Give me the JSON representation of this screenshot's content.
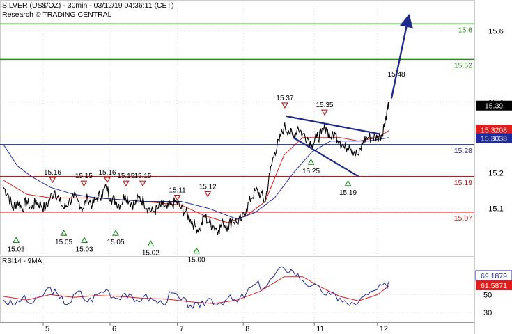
{
  "header": {
    "title": "SILVER (US$/OZ) - 30min - 03/12/19 04:36:11 (CET)",
    "subtitle": "Research © TRADING CENTRAL"
  },
  "chart_data": [
    {
      "type": "line",
      "name": "price",
      "x_labels": [
        "5",
        "6",
        "7",
        "8",
        "11",
        "12"
      ],
      "ylim": [
        14.97,
        15.66
      ],
      "yticks": [
        15.1,
        15.2,
        15.4,
        15.6
      ],
      "grid": true,
      "levels": [
        {
          "label": "15.6",
          "value": 15.62,
          "color": "#2e8b1e"
        },
        {
          "label": "15.52",
          "value": 15.52,
          "color": "#2e8b1e"
        },
        {
          "label": "15.28",
          "value": 15.28,
          "color": "#1f2a8a"
        },
        {
          "label": "15.19",
          "value": 15.19,
          "color": "#c01818"
        },
        {
          "label": "15.07",
          "value": 15.09,
          "color": "#c01818"
        }
      ],
      "last_price": "15.39",
      "ma_labels": [
        {
          "text": "15.3208",
          "color": "#e21b1b"
        },
        {
          "text": "15.3038",
          "color": "#1f2a9e"
        }
      ],
      "annotations": {
        "highs": [
          {
            "text": "15.16",
            "t": 0.105,
            "y": 15.16
          },
          {
            "text": "15.15",
            "t": 0.172,
            "y": 15.15
          },
          {
            "text": "15.16",
            "t": 0.222,
            "y": 15.16
          },
          {
            "text": "15.15",
            "t": 0.262,
            "y": 15.15
          },
          {
            "text": "15.15",
            "t": 0.298,
            "y": 15.15
          },
          {
            "text": "15.11",
            "t": 0.372,
            "y": 15.11
          },
          {
            "text": "15.12",
            "t": 0.437,
            "y": 15.12
          },
          {
            "text": "15.37",
            "t": 0.602,
            "y": 15.37
          },
          {
            "text": "15.35",
            "t": 0.687,
            "y": 15.35
          }
        ],
        "lows": [
          {
            "text": "15.03",
            "t": 0.027,
            "y": 15.03
          },
          {
            "text": "15.05",
            "t": 0.129,
            "y": 15.05
          },
          {
            "text": "15.03",
            "t": 0.173,
            "y": 15.03
          },
          {
            "text": "15.05",
            "t": 0.24,
            "y": 15.05
          },
          {
            "text": "15.02",
            "t": 0.315,
            "y": 15.02
          },
          {
            "text": "15.00",
            "t": 0.413,
            "y": 15.0
          },
          {
            "text": "15.25",
            "t": 0.658,
            "y": 15.25
          },
          {
            "text": "15.19",
            "t": 0.737,
            "y": 15.19
          }
        ],
        "target": {
          "text": "15.48",
          "y": 15.48
        }
      },
      "path": [
        [
          0,
          15.16
        ],
        [
          0.01,
          15.14
        ],
        [
          0.02,
          15.1
        ],
        [
          0.03,
          15.12
        ],
        [
          0.04,
          15.1
        ],
        [
          0.05,
          15.12
        ],
        [
          0.06,
          15.1
        ],
        [
          0.07,
          15.12
        ],
        [
          0.08,
          15.11
        ],
        [
          0.09,
          15.1
        ],
        [
          0.1,
          15.13
        ],
        [
          0.11,
          15.15
        ],
        [
          0.12,
          15.12
        ],
        [
          0.13,
          15.1
        ],
        [
          0.14,
          15.12
        ],
        [
          0.15,
          15.13
        ],
        [
          0.16,
          15.12
        ],
        [
          0.17,
          15.1
        ],
        [
          0.18,
          15.13
        ],
        [
          0.19,
          15.11
        ],
        [
          0.2,
          15.13
        ],
        [
          0.21,
          15.14
        ],
        [
          0.22,
          15.16
        ],
        [
          0.23,
          15.13
        ],
        [
          0.24,
          15.12
        ],
        [
          0.25,
          15.11
        ],
        [
          0.26,
          15.14
        ],
        [
          0.27,
          15.12
        ],
        [
          0.28,
          15.11
        ],
        [
          0.29,
          15.13
        ],
        [
          0.3,
          15.12
        ],
        [
          0.31,
          15.1
        ],
        [
          0.32,
          15.09
        ],
        [
          0.33,
          15.1
        ],
        [
          0.34,
          15.11
        ],
        [
          0.35,
          15.1
        ],
        [
          0.36,
          15.11
        ],
        [
          0.37,
          15.12
        ],
        [
          0.38,
          15.1
        ],
        [
          0.39,
          15.09
        ],
        [
          0.4,
          15.07
        ],
        [
          0.41,
          15.05
        ],
        [
          0.42,
          15.04
        ],
        [
          0.43,
          15.08
        ],
        [
          0.44,
          15.06
        ],
        [
          0.45,
          15.05
        ],
        [
          0.46,
          15.04
        ],
        [
          0.47,
          15.06
        ],
        [
          0.48,
          15.05
        ],
        [
          0.49,
          15.07
        ],
        [
          0.5,
          15.06
        ],
        [
          0.51,
          15.07
        ],
        [
          0.52,
          15.1
        ],
        [
          0.53,
          15.13
        ],
        [
          0.54,
          15.15
        ],
        [
          0.55,
          15.14
        ],
        [
          0.56,
          15.12
        ],
        [
          0.57,
          15.2
        ],
        [
          0.58,
          15.26
        ],
        [
          0.59,
          15.29
        ],
        [
          0.6,
          15.33
        ],
        [
          0.61,
          15.32
        ],
        [
          0.62,
          15.3
        ],
        [
          0.63,
          15.33
        ],
        [
          0.64,
          15.31
        ],
        [
          0.65,
          15.3
        ],
        [
          0.66,
          15.28
        ],
        [
          0.67,
          15.3
        ],
        [
          0.68,
          15.31
        ],
        [
          0.69,
          15.33
        ],
        [
          0.7,
          15.3
        ],
        [
          0.71,
          15.31
        ],
        [
          0.72,
          15.29
        ],
        [
          0.73,
          15.27
        ],
        [
          0.74,
          15.28
        ],
        [
          0.75,
          15.26
        ],
        [
          0.76,
          15.25
        ],
        [
          0.77,
          15.29
        ],
        [
          0.78,
          15.3
        ],
        [
          0.79,
          15.3
        ],
        [
          0.8,
          15.3
        ],
        [
          0.81,
          15.31
        ],
        [
          0.815,
          15.34
        ],
        [
          0.82,
          15.37
        ],
        [
          0.825,
          15.4
        ]
      ],
      "moving_averages": [
        {
          "color": "#e21b1b",
          "points": [
            [
              0,
              15.18
            ],
            [
              0.05,
              15.14
            ],
            [
              0.1,
              15.13
            ],
            [
              0.2,
              15.13
            ],
            [
              0.3,
              15.12
            ],
            [
              0.38,
              15.11
            ],
            [
              0.43,
              15.08
            ],
            [
              0.48,
              15.06
            ],
            [
              0.52,
              15.08
            ],
            [
              0.56,
              15.12
            ],
            [
              0.6,
              15.25
            ],
            [
              0.64,
              15.3
            ],
            [
              0.68,
              15.3
            ],
            [
              0.72,
              15.3
            ],
            [
              0.76,
              15.29
            ],
            [
              0.8,
              15.3
            ],
            [
              0.825,
              15.32
            ]
          ]
        },
        {
          "color": "#1f2a9e",
          "points": [
            [
              0,
              15.28
            ],
            [
              0.03,
              15.22
            ],
            [
              0.06,
              15.19
            ],
            [
              0.1,
              15.16
            ],
            [
              0.15,
              15.14
            ],
            [
              0.2,
              15.13
            ],
            [
              0.3,
              15.12
            ],
            [
              0.38,
              15.12
            ],
            [
              0.44,
              15.1
            ],
            [
              0.5,
              15.07
            ],
            [
              0.54,
              15.09
            ],
            [
              0.58,
              15.13
            ],
            [
              0.62,
              15.2
            ],
            [
              0.66,
              15.26
            ],
            [
              0.7,
              15.29
            ],
            [
              0.74,
              15.29
            ],
            [
              0.78,
              15.29
            ],
            [
              0.825,
              15.3
            ]
          ]
        }
      ],
      "channel": {
        "upper": [
          [
            0.605,
            15.36
          ],
          [
            0.805,
            15.31
          ]
        ],
        "lower": [
          [
            0.62,
            15.3
          ],
          [
            0.76,
            15.19
          ]
        ]
      },
      "forecast_arrow": [
        [
          0.83,
          15.41
        ],
        [
          0.865,
          15.63
        ]
      ]
    },
    {
      "type": "line",
      "name": "oscillator",
      "title": "RSI14 - 9MA",
      "ylim": [
        20,
        90
      ],
      "yticks": [
        30,
        50
      ],
      "grid": true,
      "value_labels": [
        {
          "text": "69.1879",
          "color": "#1f2a9e"
        },
        {
          "text": "61.5871",
          "color": "#e21b1b"
        }
      ],
      "rsi": [
        [
          0,
          44
        ],
        [
          0.02,
          38
        ],
        [
          0.04,
          46
        ],
        [
          0.06,
          40
        ],
        [
          0.08,
          48
        ],
        [
          0.1,
          58
        ],
        [
          0.12,
          46
        ],
        [
          0.14,
          40
        ],
        [
          0.16,
          54
        ],
        [
          0.18,
          42
        ],
        [
          0.2,
          50
        ],
        [
          0.22,
          56
        ],
        [
          0.24,
          46
        ],
        [
          0.26,
          52
        ],
        [
          0.28,
          42
        ],
        [
          0.3,
          48
        ],
        [
          0.32,
          44
        ],
        [
          0.34,
          40
        ],
        [
          0.36,
          52
        ],
        [
          0.38,
          44
        ],
        [
          0.4,
          38
        ],
        [
          0.42,
          36
        ],
        [
          0.44,
          46
        ],
        [
          0.46,
          40
        ],
        [
          0.48,
          46
        ],
        [
          0.5,
          42
        ],
        [
          0.52,
          52
        ],
        [
          0.54,
          62
        ],
        [
          0.56,
          58
        ],
        [
          0.58,
          72
        ],
        [
          0.6,
          80
        ],
        [
          0.62,
          76
        ],
        [
          0.64,
          66
        ],
        [
          0.66,
          60
        ],
        [
          0.68,
          54
        ],
        [
          0.7,
          50
        ],
        [
          0.72,
          46
        ],
        [
          0.74,
          38
        ],
        [
          0.76,
          42
        ],
        [
          0.78,
          50
        ],
        [
          0.8,
          56
        ],
        [
          0.82,
          60
        ],
        [
          0.825,
          66
        ]
      ],
      "rsi_ma": [
        [
          0,
          48
        ],
        [
          0.05,
          44
        ],
        [
          0.1,
          50
        ],
        [
          0.15,
          47
        ],
        [
          0.2,
          49
        ],
        [
          0.25,
          48
        ],
        [
          0.3,
          46
        ],
        [
          0.35,
          45
        ],
        [
          0.4,
          42
        ],
        [
          0.45,
          40
        ],
        [
          0.5,
          44
        ],
        [
          0.55,
          54
        ],
        [
          0.6,
          70
        ],
        [
          0.64,
          70
        ],
        [
          0.68,
          58
        ],
        [
          0.72,
          48
        ],
        [
          0.76,
          43
        ],
        [
          0.8,
          50
        ],
        [
          0.825,
          60
        ]
      ]
    }
  ]
}
